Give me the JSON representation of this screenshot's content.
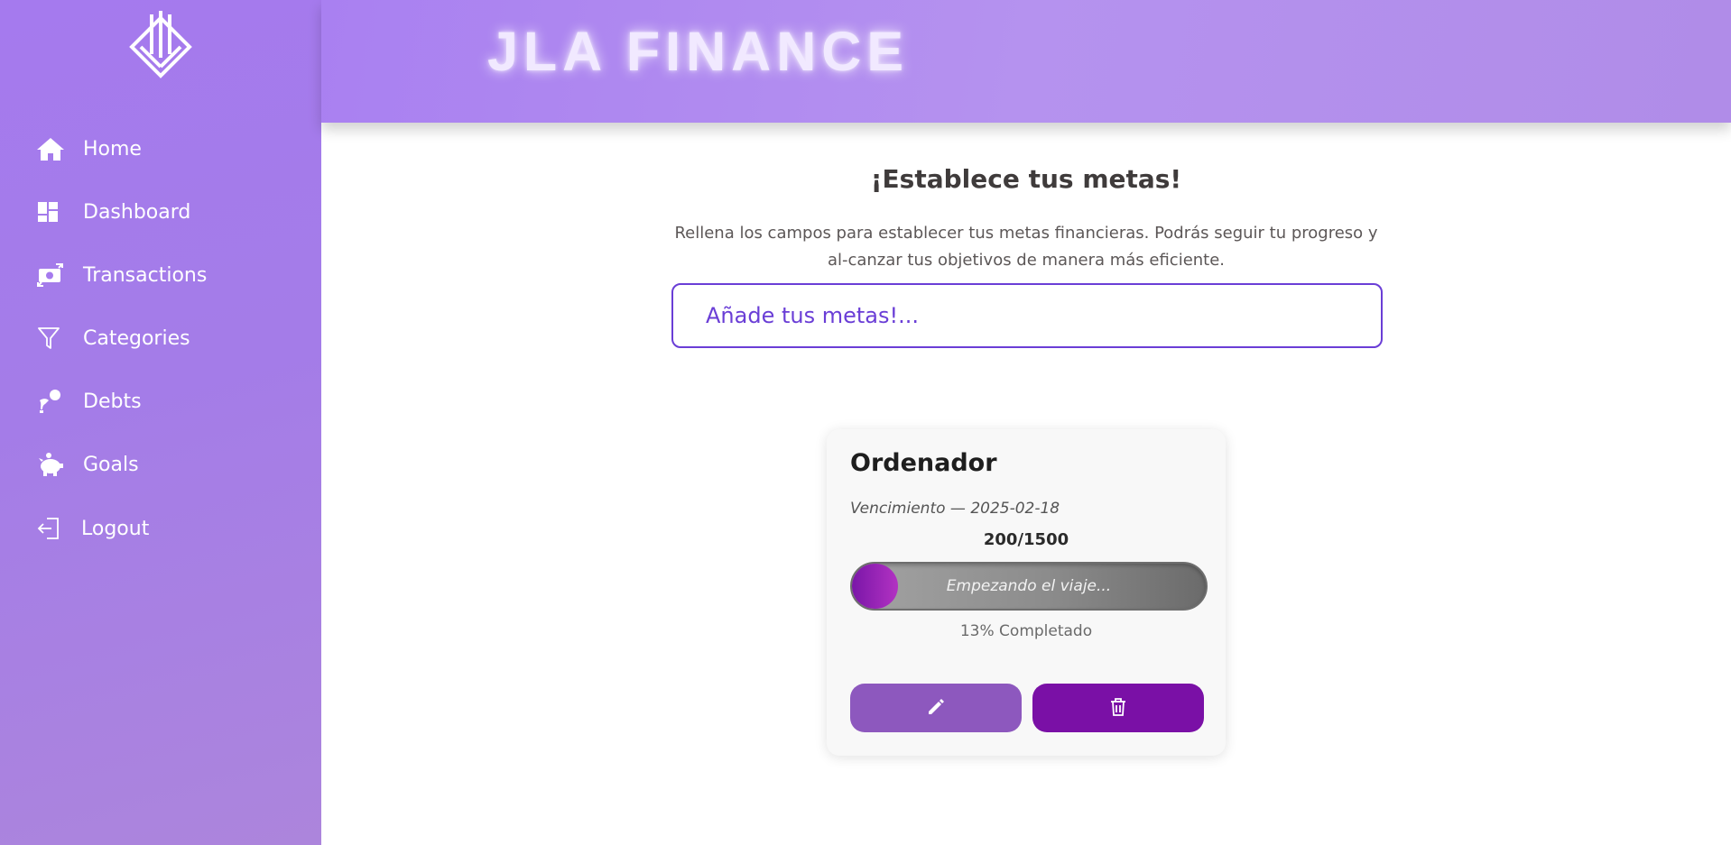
{
  "brand": {
    "name": "JLA FINANCE"
  },
  "sidebar": {
    "logo_icon": "jla-logo-icon",
    "items": [
      {
        "label": "Home",
        "icon": "home-icon"
      },
      {
        "label": "Dashboard",
        "icon": "dashboard-icon"
      },
      {
        "label": "Transactions",
        "icon": "money-exchange-icon"
      },
      {
        "label": "Categories",
        "icon": "filter-icon"
      },
      {
        "label": "Debts",
        "icon": "hand-coin-icon"
      },
      {
        "label": "Goals",
        "icon": "piggy-bank-icon"
      },
      {
        "label": "Logout",
        "icon": "logout-icon"
      }
    ]
  },
  "main": {
    "title": "¡Establece tus metas!",
    "description": "Rellena los campos para establecer tus metas financieras. Podrás seguir tu progreso y al-canzar tus objetivos de manera más eficiente.",
    "goal_input_placeholder": "Añade tus metas!..."
  },
  "goal_card": {
    "title": "Ordenador",
    "due": "Vencimiento — 2025-02-18",
    "amount": "200/1500",
    "progress_fraction": 0.13,
    "progress_text": "Empezando el viaje...",
    "percent_label": "13% Completado",
    "edit_icon": "pencil-icon",
    "delete_icon": "trash-icon"
  },
  "colors": {
    "sidebar": "#a57aee",
    "header": "#b592ef",
    "accent": "#6a3ed6",
    "edit_button": "#8d58be",
    "delete_button": "#7a10a6",
    "progress_fill": "#9a22b6"
  }
}
